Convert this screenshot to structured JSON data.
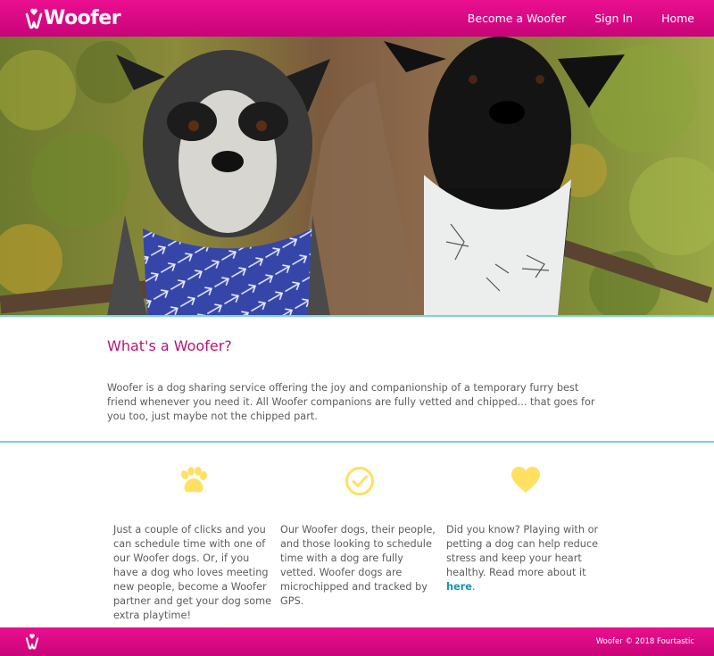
{
  "header": {
    "brand": "Woofer",
    "nav": [
      "Become a Woofer",
      "Sign In",
      "Home"
    ]
  },
  "hero": {
    "image": "two dogs wearing bandanas on a forest trail"
  },
  "about": {
    "title": "What's a Woofer?",
    "body": "Woofer is a dog sharing service offering the joy and companionship of a temporary furry best friend whenever you need it. All Woofer companions are fully vetted and chipped... that goes for you too, just maybe not the chipped part."
  },
  "features": [
    {
      "icon": "paw-icon",
      "text": "Just a couple of clicks and you can schedule time with one of our Woofer dogs. Or, if you have a dog who loves meeting new people, become a Woofer partner and get your dog some extra playtime!"
    },
    {
      "icon": "check-circle-icon",
      "text": "Our Woofer dogs, their people, and those looking to schedule time with a dog are fully vetted. Woofer dogs are microchipped and tracked by GPS."
    },
    {
      "icon": "heart-icon",
      "text_before": "Did you know? Playing with or petting a dog can help reduce stress and keep your heart healthy. Read more about it ",
      "link": "here",
      "text_after": "."
    }
  ],
  "footer": {
    "copyright": "Woofer © 2018 Fourtastic"
  },
  "colors": {
    "brand_pink": "#d80a84",
    "accent_teal": "#1596a8",
    "icon_yellow": "#ffe061",
    "title_magenta": "#b7147b"
  }
}
